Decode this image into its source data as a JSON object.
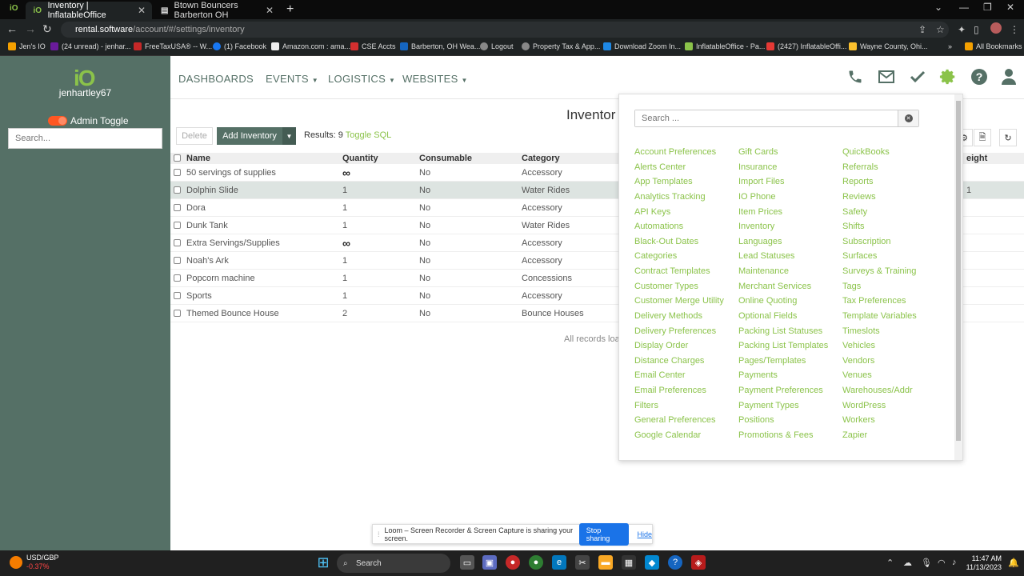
{
  "browser": {
    "tabs": [
      {
        "title": "Inventory | InflatableOffice",
        "favicon": "io-icon"
      },
      {
        "title": "Btown Bouncers Barberton OH",
        "favicon": "document-icon"
      }
    ],
    "url_host": "rental.software",
    "url_path": "/account/#/settings/inventory",
    "bookmarks": [
      "Jen's IO",
      "(24 unread) - jenhar...",
      "FreeTaxUSA® -- W...",
      "(1) Facebook",
      "Amazon.com : ama...",
      "CSE Accts",
      "Barberton, OH Wea...",
      "Logout",
      "Property Tax & App...",
      "Download Zoom In...",
      "InflatableOffice - Pa...",
      "(2427) InflatableOffi...",
      "Wayne County, Ohi..."
    ],
    "all_bookmarks": "All Bookmarks"
  },
  "sidebar": {
    "logo": "iO",
    "username": "jenhartley67",
    "admin_toggle": "Admin Toggle",
    "search_placeholder": "Search..."
  },
  "topnav": {
    "items": [
      "DASHBOARDS",
      "EVENTS",
      "LOGISTICS",
      "WEBSITES"
    ]
  },
  "main": {
    "title": "Inventor",
    "delete_label": "Delete",
    "add_label": "Add Inventory",
    "results_label": "Results: 9",
    "toggle_sql": "Toggle SQL",
    "columns": [
      "Name",
      "Quantity",
      "Consumable",
      "Category",
      "eight"
    ],
    "rows": [
      {
        "name": "50 servings of supplies",
        "qty": "∞",
        "consumable": "No",
        "category": "Accessory",
        "extra": ""
      },
      {
        "name": "Dolphin Slide",
        "qty": "1",
        "consumable": "No",
        "category": "Water Rides",
        "extra": "1"
      },
      {
        "name": "Dora",
        "qty": "1",
        "consumable": "No",
        "category": "Accessory",
        "extra": ""
      },
      {
        "name": "Dunk Tank",
        "qty": "1",
        "consumable": "No",
        "category": "Water Rides",
        "extra": ""
      },
      {
        "name": "Extra Servings/Supplies",
        "qty": "∞",
        "consumable": "No",
        "category": "Accessory",
        "extra": ""
      },
      {
        "name": "Noah's Ark",
        "qty": "1",
        "consumable": "No",
        "category": "Accessory",
        "extra": ""
      },
      {
        "name": "Popcorn machine",
        "qty": "1",
        "consumable": "No",
        "category": "Concessions",
        "extra": ""
      },
      {
        "name": "Sports",
        "qty": "1",
        "consumable": "No",
        "category": "Accessory",
        "extra": ""
      },
      {
        "name": "Themed Bounce House",
        "qty": "2",
        "consumable": "No",
        "category": "Bounce Houses",
        "extra": ""
      }
    ],
    "loaded_text": "All records loa"
  },
  "settings_menu": {
    "search_placeholder": "Search ...",
    "col1": [
      "Account Preferences",
      "Alerts Center",
      "App Templates",
      "Analytics Tracking",
      "API Keys",
      "Automations",
      "Black-Out Dates",
      "Categories",
      "Contract Templates",
      "Customer Types",
      "Customer Merge Utility",
      "Delivery Methods",
      "Delivery Preferences",
      "Display Order",
      "Distance Charges",
      "Email Center",
      "Email Preferences",
      "Filters",
      "General Preferences",
      "Google Calendar"
    ],
    "col2": [
      "Gift Cards",
      "Insurance",
      "Import Files",
      "IO Phone",
      "Item Prices",
      "Inventory",
      "Languages",
      "Lead Statuses",
      "Maintenance",
      "Merchant Services",
      "Online Quoting",
      "Optional Fields",
      "Packing List Statuses",
      "Packing List Templates",
      "Pages/Templates",
      "Payments",
      "Payment Preferences",
      "Payment Types",
      "Positions",
      "Promotions & Fees"
    ],
    "col3": [
      "QuickBooks",
      "Referrals",
      "Reports",
      "Reviews",
      "Safety",
      "Shifts",
      "Subscription",
      "Surfaces",
      "Surveys & Training",
      "Tags",
      "Tax Preferences",
      "Template Variables",
      "Timeslots",
      "Vehicles",
      "Vendors",
      "Venues",
      "Warehouses/Addr",
      "WordPress",
      "Workers",
      "Zapier"
    ]
  },
  "loom": {
    "message": "Loom – Screen Recorder & Screen Capture is sharing your screen.",
    "stop": "Stop sharing",
    "hide": "Hide"
  },
  "taskbar": {
    "ticker": "USD/GBP",
    "ticker_change": "-0.37%",
    "search": "Search",
    "time": "11:47 AM",
    "date": "11/13/2023"
  },
  "colors": {
    "brand_green": "#8bc34a",
    "sidebar": "#557066"
  }
}
